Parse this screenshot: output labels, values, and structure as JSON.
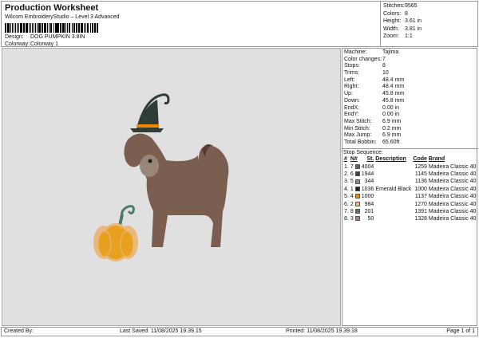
{
  "header": {
    "title": "Production Worksheet",
    "subtitle": "Wilcom EmbroideryStudio – Level 3 Advanced",
    "design_label": "Design:",
    "design": "DOG PUMPKIN 3.8IN",
    "colorway_label": "Colorway:",
    "colorway": "Colorway 1"
  },
  "stats": [
    {
      "k": "Stitches:",
      "v": "9565"
    },
    {
      "k": "Colors:",
      "v": "8"
    },
    {
      "k": "Height:",
      "v": "3.61 in"
    },
    {
      "k": "Width:",
      "v": "3.81 in"
    },
    {
      "k": "Zoom:",
      "v": "1:1"
    }
  ],
  "properties": [
    {
      "k": "Machine:",
      "v": "Tajima"
    },
    {
      "k": "Color changes:",
      "v": "7"
    },
    {
      "k": "Stops:",
      "v": "8"
    },
    {
      "k": "Trims:",
      "v": "10"
    },
    {
      "k": "Left:",
      "v": "48.4 mm"
    },
    {
      "k": "Right:",
      "v": "48.4 mm"
    },
    {
      "k": "Up:",
      "v": "45.8 mm"
    },
    {
      "k": "Down:",
      "v": "45.8 mm"
    },
    {
      "k": "EndX:",
      "v": "0.00 in"
    },
    {
      "k": "EndY:",
      "v": "0.00 in"
    },
    {
      "k": "Max Stitch:",
      "v": "6.9 mm"
    },
    {
      "k": "Min Stitch:",
      "v": "0.2 mm"
    },
    {
      "k": "Max Jump:",
      "v": "6.9 mm"
    },
    {
      "k": "Total Bobbin:",
      "v": "65.60ft"
    }
  ],
  "sequence": {
    "title": "Stop Sequence:",
    "columns": [
      "#",
      "N#",
      "St.",
      "Description",
      "Code",
      "Brand"
    ],
    "rows": [
      {
        "n": "1.",
        "c": "7",
        "color": "#7a5a50",
        "st": "4004",
        "desc": "",
        "code": "1259",
        "brand": "Madeira Classic 40"
      },
      {
        "n": "2.",
        "c": "6",
        "color": "#5a3a30",
        "st": "1944",
        "desc": "",
        "code": "1145",
        "brand": "Madeira Classic 40"
      },
      {
        "n": "3.",
        "c": "5",
        "color": "#9a8678",
        "st": "344",
        "desc": "",
        "code": "1136",
        "brand": "Madeira Classic 40"
      },
      {
        "n": "4.",
        "c": "1",
        "color": "#1e1e1e",
        "st": "1036",
        "desc": "Emerald Black",
        "code": "1000",
        "brand": "Madeira Classic 40"
      },
      {
        "n": "5.",
        "c": "4",
        "color": "#f08800",
        "st": "1000",
        "desc": "",
        "code": "1137",
        "brand": "Madeira Classic 40"
      },
      {
        "n": "6.",
        "c": "2",
        "color": "#eab87a",
        "st": "984",
        "desc": "",
        "code": "1270",
        "brand": "Madeira Classic 40"
      },
      {
        "n": "7.",
        "c": "8",
        "color": "#4a7a68",
        "st": "201",
        "desc": "",
        "code": "1391",
        "brand": "Madeira Classic 40"
      },
      {
        "n": "8.",
        "c": "3",
        "color": "#a08878",
        "st": "50",
        "desc": "",
        "code": "1328",
        "brand": "Madeira Classic 40"
      }
    ]
  },
  "footer": {
    "created": "Created By:",
    "saved": "Last Saved: 11/08/2025 19.39.15",
    "printed": "Printed: 11/08/2025 19.39.18",
    "page": "Page 1 of 1"
  }
}
